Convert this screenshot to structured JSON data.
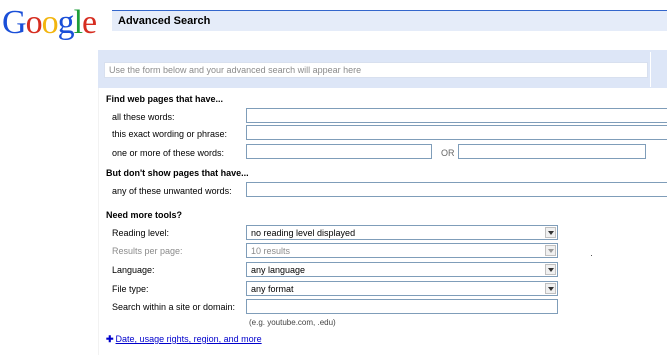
{
  "logo": {
    "letters": [
      {
        "ch": "G",
        "color": "#1a4fd8"
      },
      {
        "ch": "o",
        "color": "#d62d20"
      },
      {
        "ch": "o",
        "color": "#f2b50f"
      },
      {
        "ch": "g",
        "color": "#1a4fd8"
      },
      {
        "ch": "l",
        "color": "#1f9e3a"
      },
      {
        "ch": "e",
        "color": "#d62d20"
      }
    ]
  },
  "header": {
    "title": "Advanced Search"
  },
  "preview": {
    "placeholder": "Use the form below and your advanced search will appear here"
  },
  "find_section": {
    "heading": "Find web pages that have...",
    "all_words_label": "all these words:",
    "exact_phrase_label": "this exact wording or phrase:",
    "any_words_label": "one or more of these words:",
    "or_label": "OR"
  },
  "exclude_section": {
    "heading": "But don't show pages that have...",
    "unwanted_label": "any of these unwanted words:"
  },
  "tools_section": {
    "heading": "Need more tools?",
    "reading_level": {
      "label": "Reading level:",
      "value": "no reading level displayed"
    },
    "results_per_page": {
      "label": "Results per page:",
      "value": "10 results"
    },
    "language": {
      "label": "Language:",
      "value": "any language"
    },
    "file_type": {
      "label": "File type:",
      "value": "any format"
    },
    "site_domain": {
      "label": "Search within a site or domain:",
      "hint": "(e.g. youtube.com, .edu)"
    }
  },
  "more_link": {
    "icon": "plus-icon",
    "label": "Date, usage rights, region, and more"
  },
  "colors": {
    "header_bg": "#e5ecf9",
    "header_rule": "#3366cc",
    "preview_bg": "#dde6f7",
    "link": "#0000cc"
  }
}
